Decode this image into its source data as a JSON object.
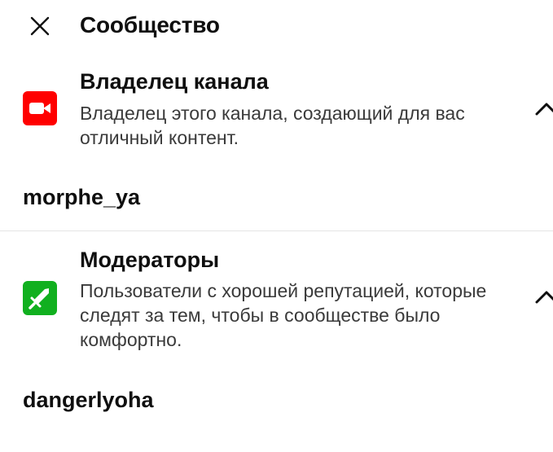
{
  "header": {
    "close_icon": "close-icon",
    "title": "Сообщество"
  },
  "roles": [
    {
      "icon": "video-camera-icon",
      "icon_color": "#ff0000",
      "title": "Владелец канала",
      "description": "Владелец этого канала, создающий для вас отличный контент.",
      "expanded": true,
      "members": [
        "morphe_ya"
      ]
    },
    {
      "icon": "sword-icon",
      "icon_color": "#11b01f",
      "title": "Модераторы",
      "description": "Пользователи с хорошей репутацией, которые следят за тем, чтобы в сообществе было комфортно.",
      "expanded": true,
      "members": [
        "dangerlyoha"
      ]
    }
  ],
  "colors": {
    "text_primary": "#0f0f0f",
    "text_secondary": "#3a3a3a",
    "divider": "#e5e5e5",
    "background": "#ffffff"
  }
}
